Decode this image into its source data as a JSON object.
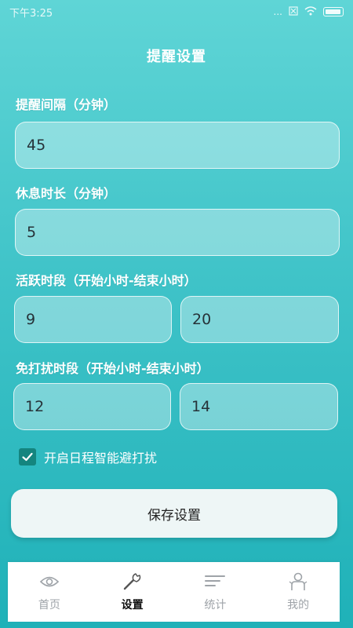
{
  "status_bar": {
    "time": "下午3:25",
    "indicators": "..."
  },
  "title": "提醒设置",
  "fields": {
    "interval": {
      "label": "提醒间隔（分钟）",
      "value": "45"
    },
    "rest": {
      "label": "休息时长（分钟）",
      "value": "5"
    },
    "active": {
      "label": "活跃时段（开始小时-结束小时）",
      "start": "9",
      "end": "20"
    },
    "dnd": {
      "label": "免打扰时段（开始小时-结束小时）",
      "start": "12",
      "end": "14"
    }
  },
  "smart_avoid": {
    "label": "开启日程智能避打扰",
    "checked": true
  },
  "save_label": "保存设置",
  "nav": [
    {
      "label": "首页",
      "icon": "eye-icon",
      "active": false
    },
    {
      "label": "设置",
      "icon": "wrench-icon",
      "active": true
    },
    {
      "label": "统计",
      "icon": "bars-icon",
      "active": false
    },
    {
      "label": "我的",
      "icon": "person-icon",
      "active": false
    }
  ],
  "colors": {
    "accent": "#14857f",
    "gradient_top": "#5fd5d6",
    "gradient_bottom": "#1fb1b8"
  }
}
